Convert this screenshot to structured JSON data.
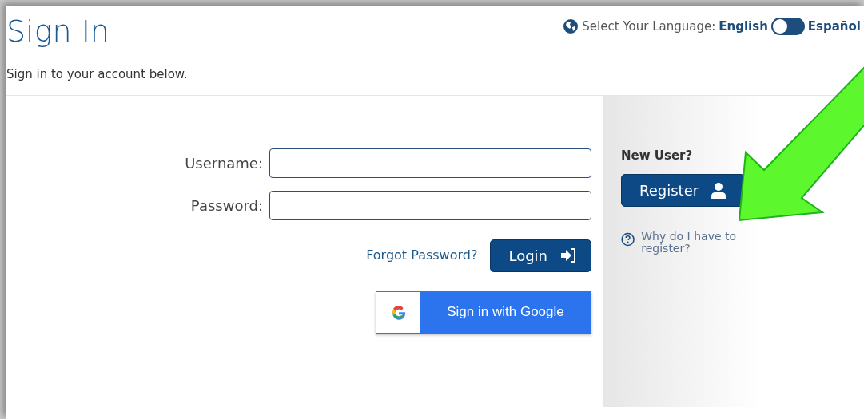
{
  "page": {
    "title": "Sign In",
    "subtitle": "Sign in to your account below."
  },
  "language": {
    "label": "Select Your Language:",
    "option_left": "English",
    "option_right": "Español",
    "switch": {
      "on": false
    }
  },
  "form": {
    "fields": [
      {
        "label": "Username:"
      },
      {
        "label": "Password:"
      }
    ],
    "forgot_link": "Forgot Password?",
    "login_button": "Login",
    "google_button": "Sign in with Google"
  },
  "register": {
    "heading": "New User?",
    "button": "Register",
    "help_link": "Why do I have to register?"
  }
}
